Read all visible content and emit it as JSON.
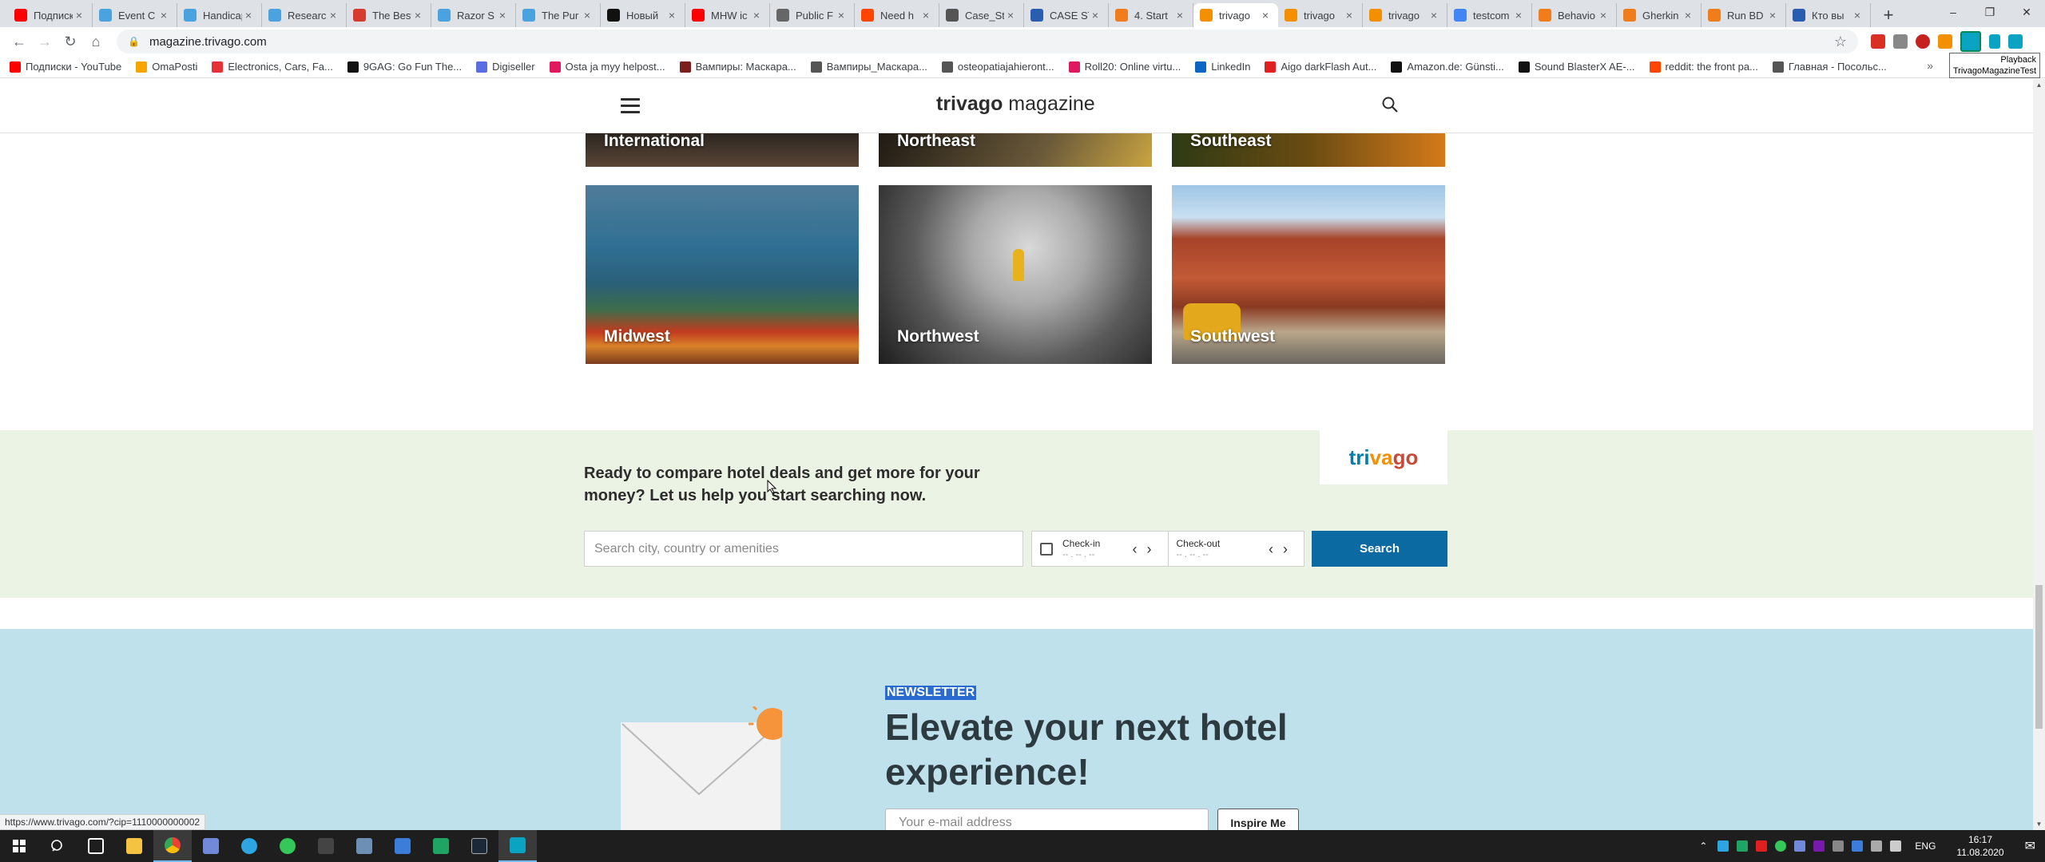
{
  "browser": {
    "tabs": [
      {
        "title": "Подписки",
        "color": "#ff0000"
      },
      {
        "title": "Event C",
        "color": "#4aa3df"
      },
      {
        "title": "Handicap",
        "color": "#4aa3df"
      },
      {
        "title": "Research",
        "color": "#4aa3df"
      },
      {
        "title": "The Best",
        "color": "#d63b30"
      },
      {
        "title": "Razor S",
        "color": "#4aa3df"
      },
      {
        "title": "The Pur",
        "color": "#4aa3df"
      },
      {
        "title": "Новый",
        "color": "#111111"
      },
      {
        "title": "MHW ic",
        "color": "#ff0000"
      },
      {
        "title": "Public F",
        "color": "#666666"
      },
      {
        "title": "Need h",
        "color": "#ff4500"
      },
      {
        "title": "Case_St",
        "color": "#555555"
      },
      {
        "title": "CASE ST",
        "color": "#2a5db0"
      },
      {
        "title": "4. Start",
        "color": "#f07c1b"
      },
      {
        "title": "trivago",
        "color": "#f48f00",
        "active": true
      },
      {
        "title": "trivago",
        "color": "#f48f00"
      },
      {
        "title": "trivago",
        "color": "#f48f00"
      },
      {
        "title": "testcom",
        "color": "#4285f4"
      },
      {
        "title": "Behavio",
        "color": "#f07c1b"
      },
      {
        "title": "Gherkin",
        "color": "#f07c1b"
      },
      {
        "title": "Run BD",
        "color": "#f07c1b"
      },
      {
        "title": "Кто вы",
        "color": "#2a5db0"
      }
    ],
    "url": "magazine.trivago.com",
    "bookmarks": [
      {
        "label": "Подписки - YouTube",
        "color": "#ff0000"
      },
      {
        "label": "OmaPosti",
        "color": "#f7a600"
      },
      {
        "label": "Electronics, Cars, Fa...",
        "color": "#e53238"
      },
      {
        "label": "9GAG: Go Fun The...",
        "color": "#111111"
      },
      {
        "label": "Digiseller",
        "color": "#5b6ee1"
      },
      {
        "label": "Osta ja myy helpost...",
        "color": "#e0195e"
      },
      {
        "label": "Вампиры: Маскара...",
        "color": "#7a1e1e"
      },
      {
        "label": "Вампиры_Маскара...",
        "color": "#555555"
      },
      {
        "label": "osteopatiajahieront...",
        "color": "#555555"
      },
      {
        "label": "Roll20: Online virtu...",
        "color": "#e0195e"
      },
      {
        "label": "LinkedIn",
        "color": "#0a66c2"
      },
      {
        "label": "Aigo darkFlash Aut...",
        "color": "#e02020"
      },
      {
        "label": "Amazon.de: Günsti...",
        "color": "#111111"
      },
      {
        "label": "Sound BlasterX AE-...",
        "color": "#111111"
      },
      {
        "label": "reddit: the front pa...",
        "color": "#ff4500"
      },
      {
        "label": "Главная - Посольс...",
        "color": "#555555"
      }
    ],
    "more": "»",
    "tooltip": {
      "line1": "Playback",
      "line2": "TrivagoMagazineTest"
    },
    "status_url": "https://www.trivago.com/?cip=1110000000002"
  },
  "site": {
    "logo_brand": "trivago",
    "logo_rest": " magazine",
    "top_regions": [
      "International",
      "Northeast",
      "Southeast"
    ],
    "regions": [
      "Midwest",
      "Northwest",
      "Southwest"
    ],
    "cta_heading": "Ready to compare hotel deals and get more for your money? Let us help you start searching now.",
    "cta_logo": "trivago",
    "search_placeholder": "Search city, country or amenities",
    "checkin_label": "Check-in",
    "checkin_value": "-- . -- . --",
    "checkout_label": "Check-out",
    "checkout_value": "-- . -- . --",
    "search_button": "Search",
    "newsletter_tag": "NEWSLETTER",
    "newsletter_heading": "Elevate your next hotel experience!",
    "email_placeholder": "Your e-mail address",
    "inspire_button": "Inspire Me"
  },
  "taskbar": {
    "lang": "ENG",
    "time": "16:17",
    "date": "11.08.2020"
  }
}
